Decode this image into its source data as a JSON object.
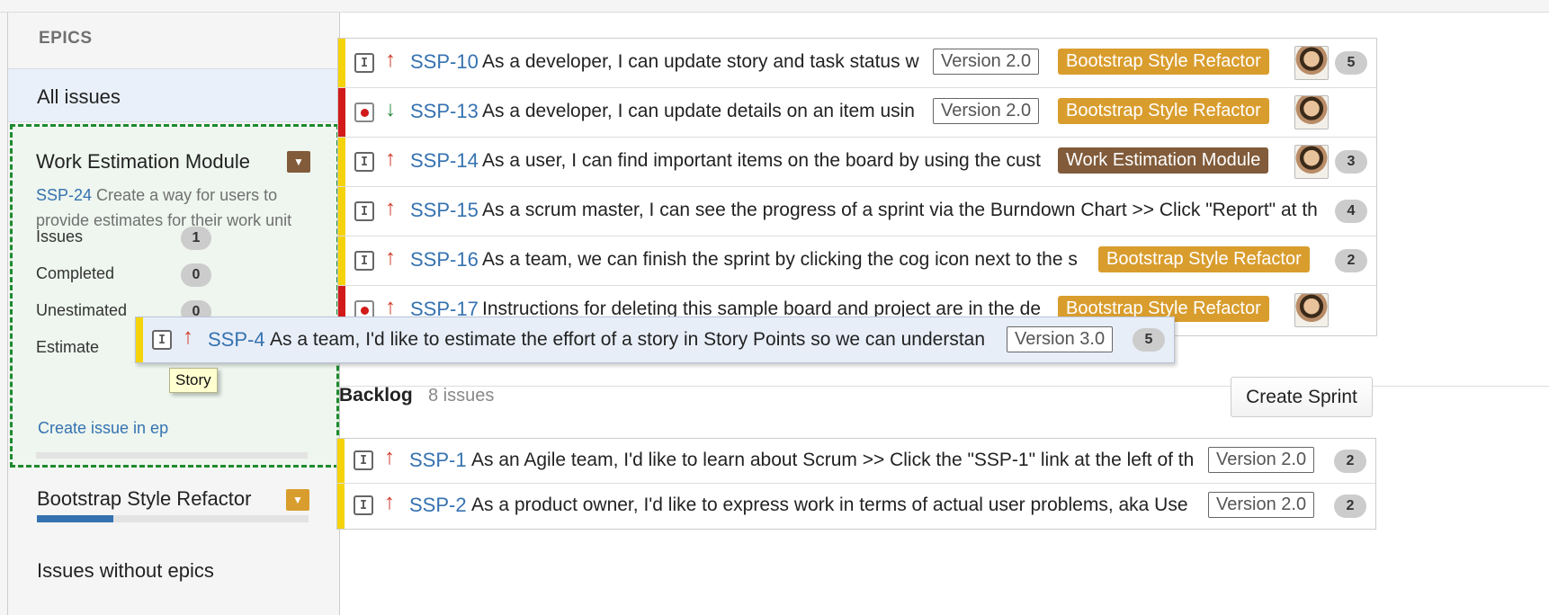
{
  "sidebar": {
    "title": "EPICS",
    "all_issues": "All issues",
    "selected_epic": {
      "name": "Work Estimation Module",
      "desc_key": "SSP-24",
      "desc_text": " Create a way for users to provide estimates for their work unit",
      "stats": [
        {
          "label": "Issues",
          "value": "1"
        },
        {
          "label": "Completed",
          "value": "0"
        },
        {
          "label": "Unestimated",
          "value": "0"
        },
        {
          "label": "Estimate",
          "value": ""
        }
      ],
      "create_link": "Create issue in ep",
      "tooltip": "Story",
      "color": "#815b3a"
    },
    "epic2": {
      "name": "Bootstrap Style Refactor",
      "progress": 0.28,
      "color": "#d99d2e"
    },
    "no_epics": "Issues without epics"
  },
  "sprint_issues": [
    {
      "key": "SSP-10",
      "summary": "As a developer, I can update story and task status w",
      "version": "Version 2.0",
      "epic": "Bootstrap Style Refactor",
      "epic_color": "orange",
      "points": "5",
      "avatar": true,
      "type": "story",
      "priority": "up",
      "grabber": "yellow"
    },
    {
      "key": "SSP-13",
      "summary": "As a developer, I can update details on an item usin",
      "version": "Version 2.0",
      "epic": "Bootstrap Style Refactor",
      "epic_color": "orange",
      "points": "",
      "avatar": true,
      "type": "bug",
      "priority": "down",
      "grabber": "red"
    },
    {
      "key": "SSP-14",
      "summary": "As a user, I can find important items on the board by using the cust",
      "version": "",
      "epic": "Work Estimation Module",
      "epic_color": "brown",
      "points": "3",
      "avatar": true,
      "type": "story",
      "priority": "up",
      "grabber": "yellow"
    },
    {
      "key": "SSP-15",
      "summary": "As a scrum master, I can see the progress of a sprint via the Burndown Chart >> Click \"Report\" at th",
      "version": "",
      "epic": "",
      "epic_color": "",
      "points": "4",
      "avatar": false,
      "type": "story",
      "priority": "up",
      "grabber": "yellow"
    },
    {
      "key": "SSP-16",
      "summary": "As a team, we can finish the sprint by clicking the cog icon next to the s",
      "version": "",
      "epic": "Bootstrap Style Refactor",
      "epic_color": "orange",
      "points": "2",
      "avatar": false,
      "type": "story",
      "priority": "up",
      "grabber": "yellow"
    },
    {
      "key": "SSP-17",
      "summary": "Instructions for deleting this sample board and project are in the de",
      "version": "",
      "epic": "Bootstrap Style Refactor",
      "epic_color": "orange",
      "points": "",
      "avatar": true,
      "type": "bug",
      "priority": "up",
      "grabber": "red"
    }
  ],
  "dragged_issue": {
    "key": "SSP-4",
    "summary": "As a team, I'd like to estimate the effort of a story in Story Points so we can understan",
    "version": "Version 3.0",
    "points": "5"
  },
  "backlog": {
    "title": "Backlog",
    "count": "8 issues",
    "create_sprint": "Create Sprint",
    "issues": [
      {
        "key": "SSP-1",
        "summary": "As an Agile team, I'd like to learn about Scrum >> Click the \"SSP-1\" link at the left of th",
        "version": "Version 2.0",
        "points": "2"
      },
      {
        "key": "SSP-2",
        "summary": "As a product owner, I'd like to express work in terms of actual user problems, aka Use",
        "version": "Version 2.0",
        "points": "2"
      }
    ]
  }
}
